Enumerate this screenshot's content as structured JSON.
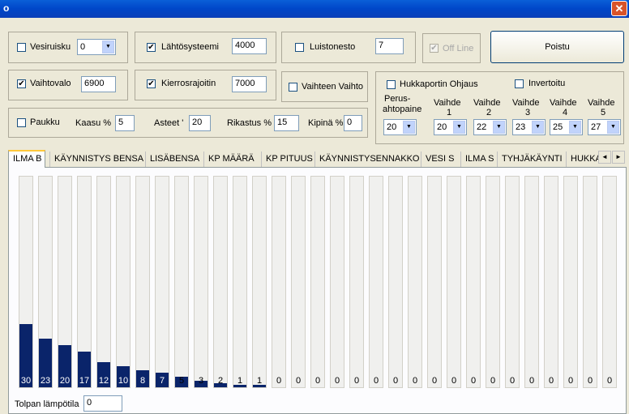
{
  "window": {
    "title": "o",
    "close_glyph": "✕"
  },
  "row1": {
    "vesiruisku": {
      "label": "Vesiruisku",
      "checked": false,
      "value": "0"
    },
    "lahtosysteemi": {
      "label": "Lähtösysteemi",
      "checked": true,
      "value": "4000"
    },
    "luistonesto": {
      "label": "Luistonesto",
      "checked": false,
      "value": "7"
    },
    "offline": {
      "label": "Off Line",
      "checked": true,
      "disabled": true
    },
    "poistu_label": "Poistu"
  },
  "row2": {
    "vaihtovalo": {
      "label": "Vaihtovalo",
      "checked": true,
      "value": "6900"
    },
    "kierrosrajoitin": {
      "label": "Kierrosrajoitin",
      "checked": true,
      "value": "7000"
    },
    "vaihteen_vaihto": {
      "label": "Vaihteen Vaihto",
      "checked": false
    }
  },
  "row3": {
    "paukku": {
      "label": "Paukku",
      "checked": false
    },
    "kaasu": {
      "label": "Kaasu %",
      "value": "5"
    },
    "asteet": {
      "label": "Asteet '",
      "value": "20"
    },
    "rikastus": {
      "label": "Rikastus %",
      "value": "15"
    },
    "kipina": {
      "label": "Kipinä %",
      "value": "0"
    }
  },
  "boost": {
    "hukkaportin_ohjaus": {
      "label": "Hukkaportin Ohjaus",
      "checked": false
    },
    "invertoitu": {
      "label": "Invertoitu",
      "checked": false
    },
    "perus": {
      "label_line1": "Perus-",
      "label_line2": "ahtopaine",
      "value": "20"
    },
    "gears": [
      {
        "label": "Vaihde",
        "num": "1",
        "value": "20"
      },
      {
        "label": "Vaihde",
        "num": "2",
        "value": "22"
      },
      {
        "label": "Vaihde",
        "num": "3",
        "value": "23"
      },
      {
        "label": "Vaihde",
        "num": "4",
        "value": "25"
      },
      {
        "label": "Vaihde",
        "num": "5",
        "value": "27"
      }
    ]
  },
  "tabs": [
    {
      "label": "ILMA B",
      "active": true
    },
    {
      "label": "KÄYNNISTYS BENSA"
    },
    {
      "label": "LISÄBENSA"
    },
    {
      "label": "KP MÄÄRÄ"
    },
    {
      "label": "KP PITUUS"
    },
    {
      "label": "KÄYNNISTYSENNAKKO"
    },
    {
      "label": "VESI S"
    },
    {
      "label": "ILMA S"
    },
    {
      "label": "TYHJÄKÄYNTI"
    },
    {
      "label": "HUKKA"
    }
  ],
  "tab_scroll": {
    "left_glyph": "◄",
    "right_glyph": "►"
  },
  "chart_data": {
    "type": "bar",
    "values": [
      30,
      23,
      20,
      17,
      12,
      10,
      8,
      7,
      5,
      3,
      2,
      1,
      1,
      0,
      0,
      0,
      0,
      0,
      0,
      0,
      0,
      0,
      0,
      0,
      0,
      0,
      0,
      0,
      0,
      0,
      0
    ],
    "ylim": [
      0,
      100
    ],
    "fill_color": "#0a246a"
  },
  "footer": {
    "label": "Tolpan lämpötila",
    "value": "0"
  }
}
